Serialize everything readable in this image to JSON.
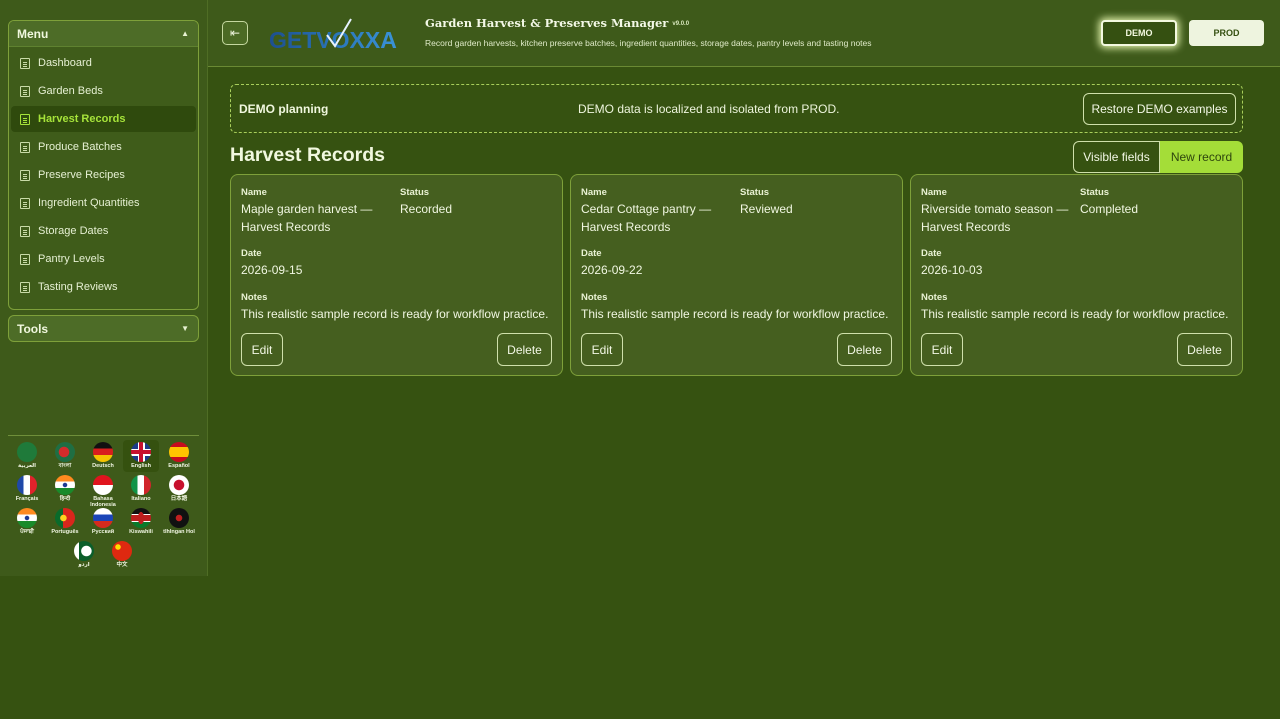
{
  "sidebar": {
    "menu_title": "Menu",
    "tools_title": "Tools",
    "items": [
      {
        "label": "Dashboard"
      },
      {
        "label": "Garden Beds"
      },
      {
        "label": "Harvest Records"
      },
      {
        "label": "Produce Batches"
      },
      {
        "label": "Preserve Recipes"
      },
      {
        "label": "Ingredient Quantities"
      },
      {
        "label": "Storage Dates"
      },
      {
        "label": "Pantry Levels"
      },
      {
        "label": "Tasting Reviews"
      }
    ],
    "active_item": "Harvest Records",
    "languages": [
      {
        "label": "العربية",
        "flag": "saudi-arabia-flag"
      },
      {
        "label": "বাংলা",
        "flag": "bangladesh-flag"
      },
      {
        "label": "Deutsch",
        "flag": "germany-flag"
      },
      {
        "label": "English",
        "flag": "uk-flag"
      },
      {
        "label": "Español",
        "flag": "spain-flag"
      },
      {
        "label": "Français",
        "flag": "france-flag"
      },
      {
        "label": "हिन्दी",
        "flag": "india-flag"
      },
      {
        "label": "Bahasa Indonesia",
        "flag": "indonesia-flag"
      },
      {
        "label": "Italiano",
        "flag": "italy-flag"
      },
      {
        "label": "日本語",
        "flag": "japan-flag"
      },
      {
        "label": "ਪੰਜਾਬੀ",
        "flag": "india-flag"
      },
      {
        "label": "Português",
        "flag": "portugal-flag"
      },
      {
        "label": "Русский",
        "flag": "russia-flag"
      },
      {
        "label": "Kiswahili",
        "flag": "kenya-flag"
      },
      {
        "label": "tlhIngan Hol",
        "flag": "klingon-flag"
      },
      {
        "label": "اردو",
        "flag": "pakistan-flag"
      },
      {
        "label": "中文",
        "flag": "china-flag"
      }
    ],
    "selected_language": "English"
  },
  "header": {
    "logo_text": "GETVOXXA",
    "title": "Garden Harvest & Preserves Manager",
    "version": "v9.0.0",
    "subtitle": "Record garden harvests, kitchen preserve batches, ingredient quantities, storage dates, pantry levels and tasting notes",
    "env_demo": "DEMO",
    "env_prod": "PROD",
    "active_env": "DEMO"
  },
  "banner": {
    "title": "DEMO planning",
    "message": "DEMO data is localized and isolated from PROD.",
    "restore_label": "Restore DEMO examples"
  },
  "main": {
    "page_title": "Harvest Records",
    "visible_fields_label": "Visible fields",
    "new_record_label": "New record",
    "field_labels": {
      "name": "Name",
      "status": "Status",
      "date": "Date",
      "notes": "Notes"
    },
    "edit_label": "Edit",
    "delete_label": "Delete",
    "records": [
      {
        "name_line1": "Maple garden harvest —",
        "name_line2": "Harvest Records",
        "status": "Recorded",
        "date": "2026-09-15",
        "notes": "This realistic sample record is ready for workflow practice."
      },
      {
        "name_line1": "Cedar Cottage pantry —",
        "name_line2": "Harvest Records",
        "status": "Reviewed",
        "date": "2026-09-22",
        "notes": "This realistic sample record is ready for workflow practice."
      },
      {
        "name_line1": "Riverside tomato season —",
        "name_line2": "Harvest Records",
        "status": "Completed",
        "date": "2026-10-03",
        "notes": "This realistic sample record is ready for workflow practice."
      }
    ]
  },
  "colors": {
    "page_bg": "#365211",
    "panel_bg": "#3e5a1a",
    "accent": "#a4dd38",
    "border": "#7ea03a"
  }
}
